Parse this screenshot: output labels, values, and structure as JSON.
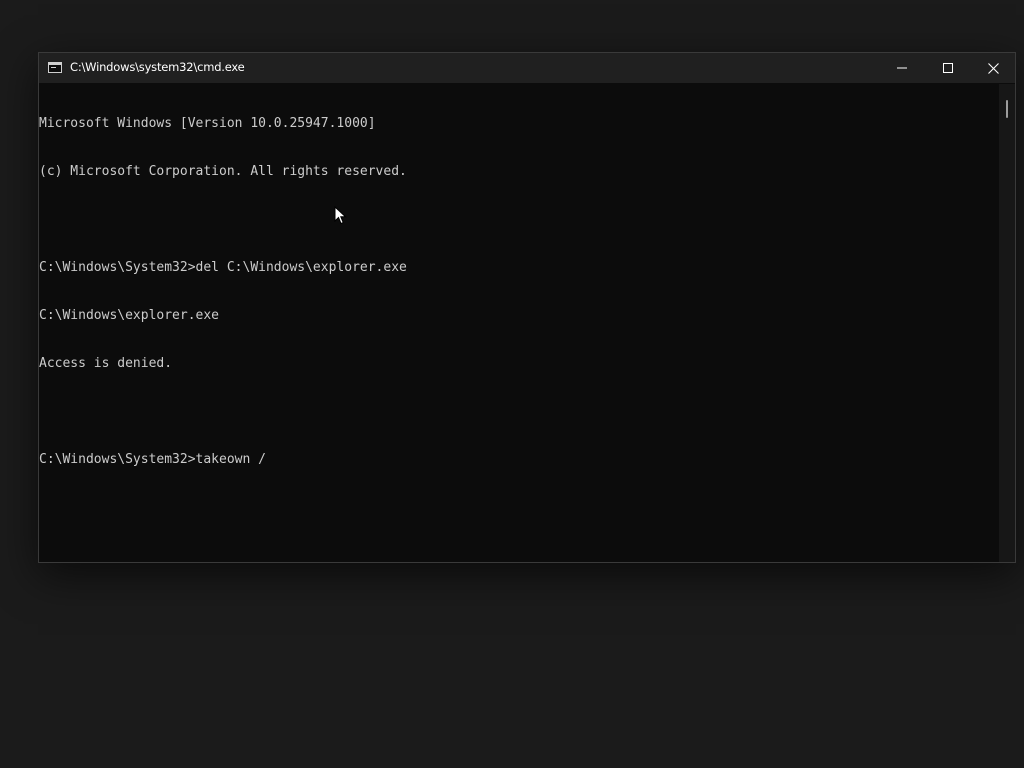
{
  "window": {
    "title": "C:\\Windows\\system32\\cmd.exe",
    "controls": {
      "minimize": "minimize-icon",
      "maximize": "maximize-icon",
      "close": "close-icon"
    }
  },
  "console": {
    "lines": [
      "Microsoft Windows [Version 10.0.25947.1000]",
      "(c) Microsoft Corporation. All rights reserved.",
      "",
      "C:\\Windows\\System32>del C:\\Windows\\explorer.exe",
      "C:\\Windows\\explorer.exe",
      "Access is denied.",
      "",
      "C:\\Windows\\System32>takeown /"
    ]
  },
  "colors": {
    "desktop": "#1b1b1b",
    "console_background": "#0c0c0c",
    "console_text": "#cccccc",
    "titlebar": "#202020"
  }
}
